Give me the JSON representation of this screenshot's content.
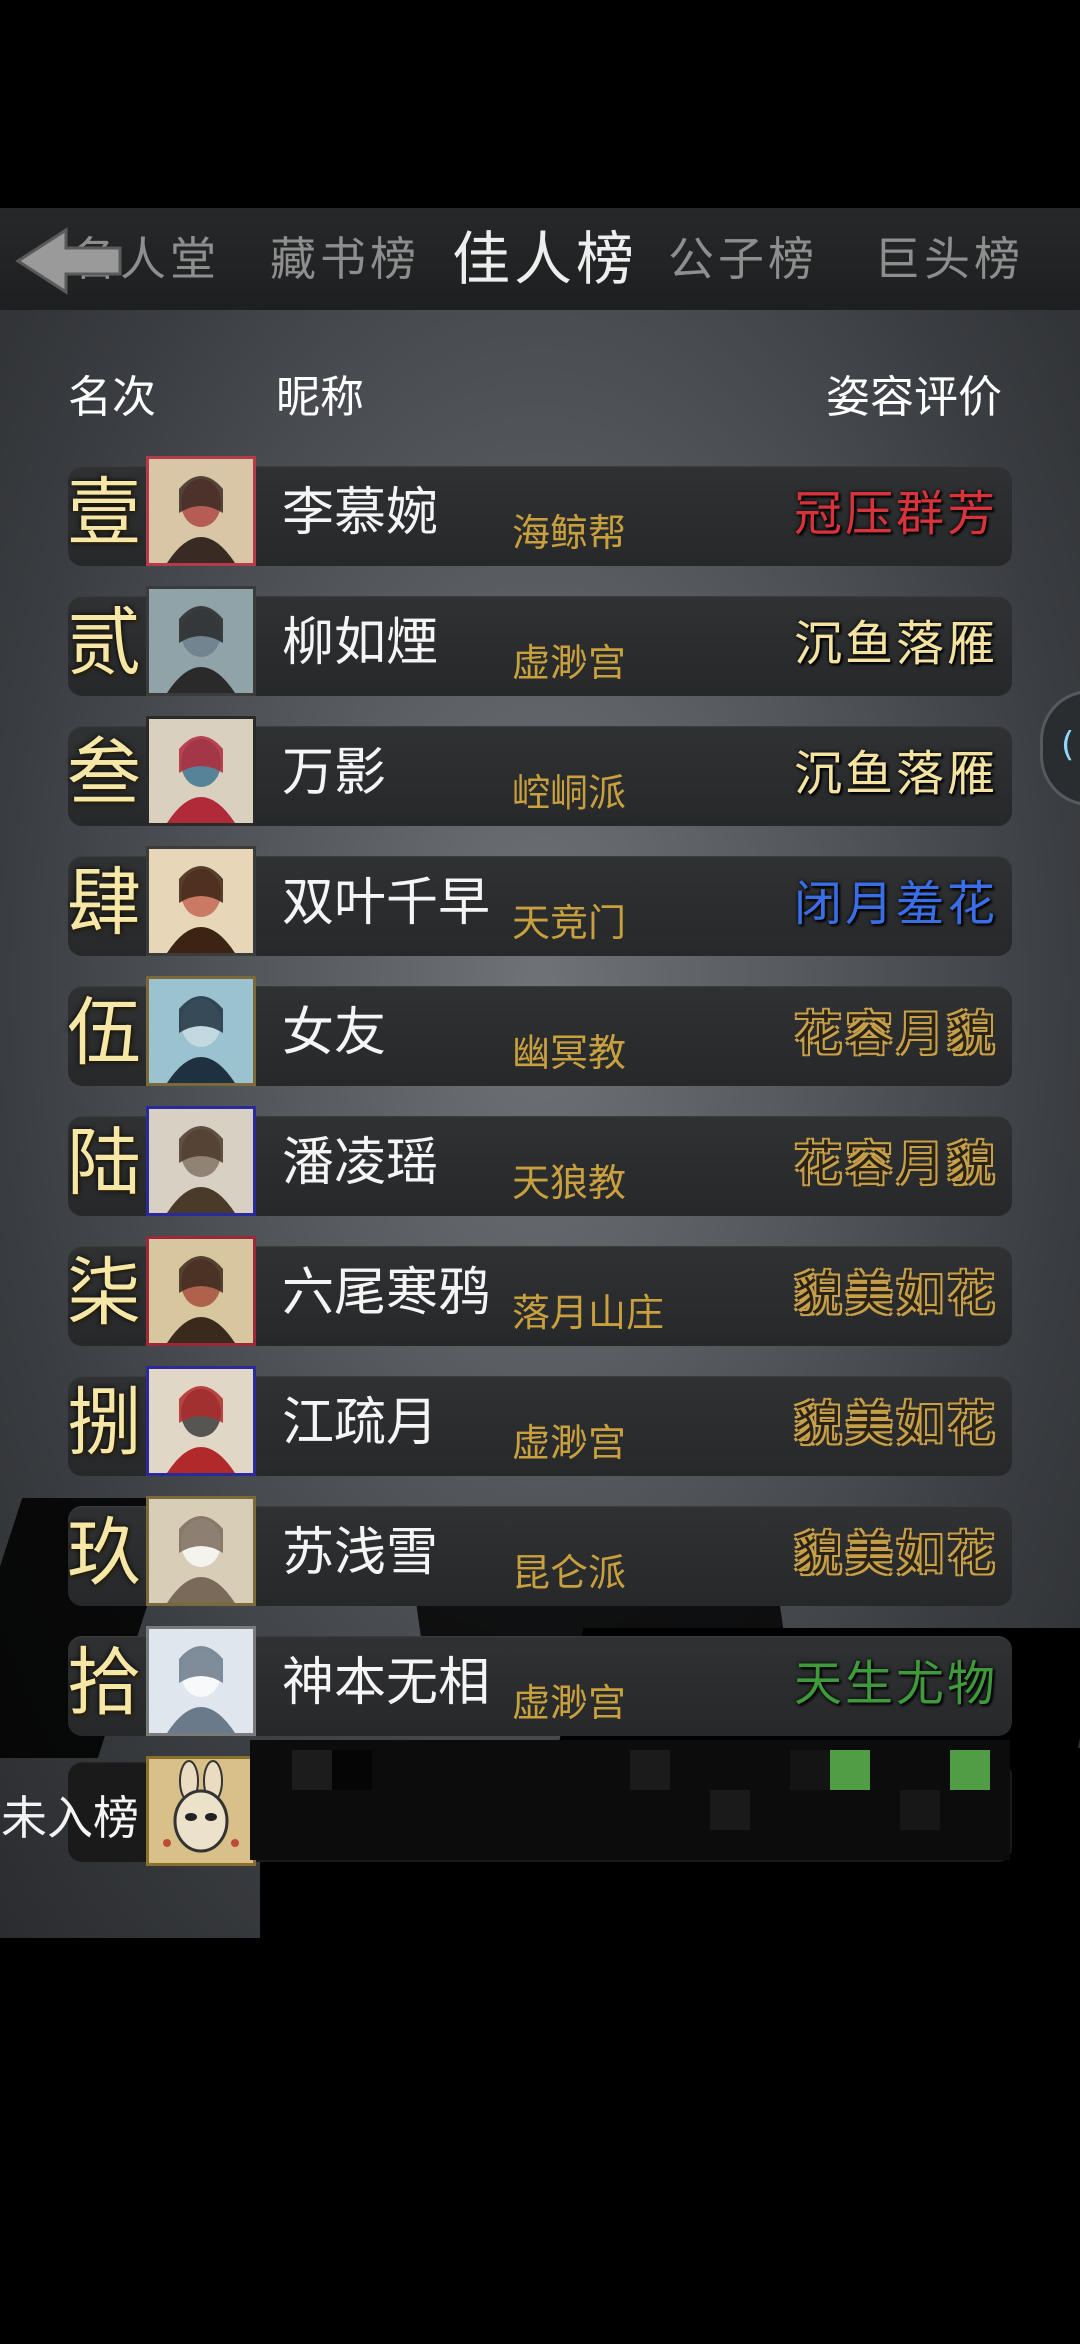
{
  "tabs": [
    {
      "label": "名人堂",
      "active": false
    },
    {
      "label": "藏书榜",
      "active": false
    },
    {
      "label": "佳人榜",
      "active": true
    },
    {
      "label": "公子榜",
      "active": false
    },
    {
      "label": "巨头榜",
      "active": false
    }
  ],
  "headers": {
    "rank": "名次",
    "nickname": "昵称",
    "rating": "姿容评价"
  },
  "rows": [
    {
      "rank": "壹",
      "nickname": "李慕婉",
      "faction": "海鲸帮",
      "rating": "冠压群芳",
      "rating_color": "#d8323a"
    },
    {
      "rank": "贰",
      "nickname": "柳如煙",
      "faction": "虚渺宫",
      "rating": "沉鱼落雁",
      "rating_color": "#f4e2a0"
    },
    {
      "rank": "叁",
      "nickname": "万影",
      "faction": "崆峒派",
      "rating": "沉鱼落雁",
      "rating_color": "#f4e2a0"
    },
    {
      "rank": "肆",
      "nickname": "双叶千早",
      "faction": "天竞门",
      "rating": "闭月羞花",
      "rating_color": "#3a6ee6"
    },
    {
      "rank": "伍",
      "nickname": "女友",
      "faction": "幽冥教",
      "rating": "花容月貌",
      "rating_color": "#2a2418"
    },
    {
      "rank": "陆",
      "nickname": "潘凌瑶",
      "faction": "天狼教",
      "rating": "花容月貌",
      "rating_color": "#2a2418"
    },
    {
      "rank": "柒",
      "nickname": "六尾寒鸦",
      "faction": "落月山庄",
      "rating": "貌美如花",
      "rating_color": "#2a2418"
    },
    {
      "rank": "捌",
      "nickname": "江疏月",
      "faction": "虚渺宫",
      "rating": "貌美如花",
      "rating_color": "#2a2418"
    },
    {
      "rank": "玖",
      "nickname": "苏浅雪",
      "faction": "昆仑派",
      "rating": "貌美如花",
      "rating_color": "#2a2418"
    },
    {
      "rank": "拾",
      "nickname": "神本无相",
      "faction": "虚渺宫",
      "rating": "天生尤物",
      "rating_color": "#3e9a3a"
    }
  ],
  "self_row": {
    "rank": "未入榜"
  },
  "icons": {
    "back": "back-arrow-icon",
    "side": "side-panel-handle-icon"
  }
}
